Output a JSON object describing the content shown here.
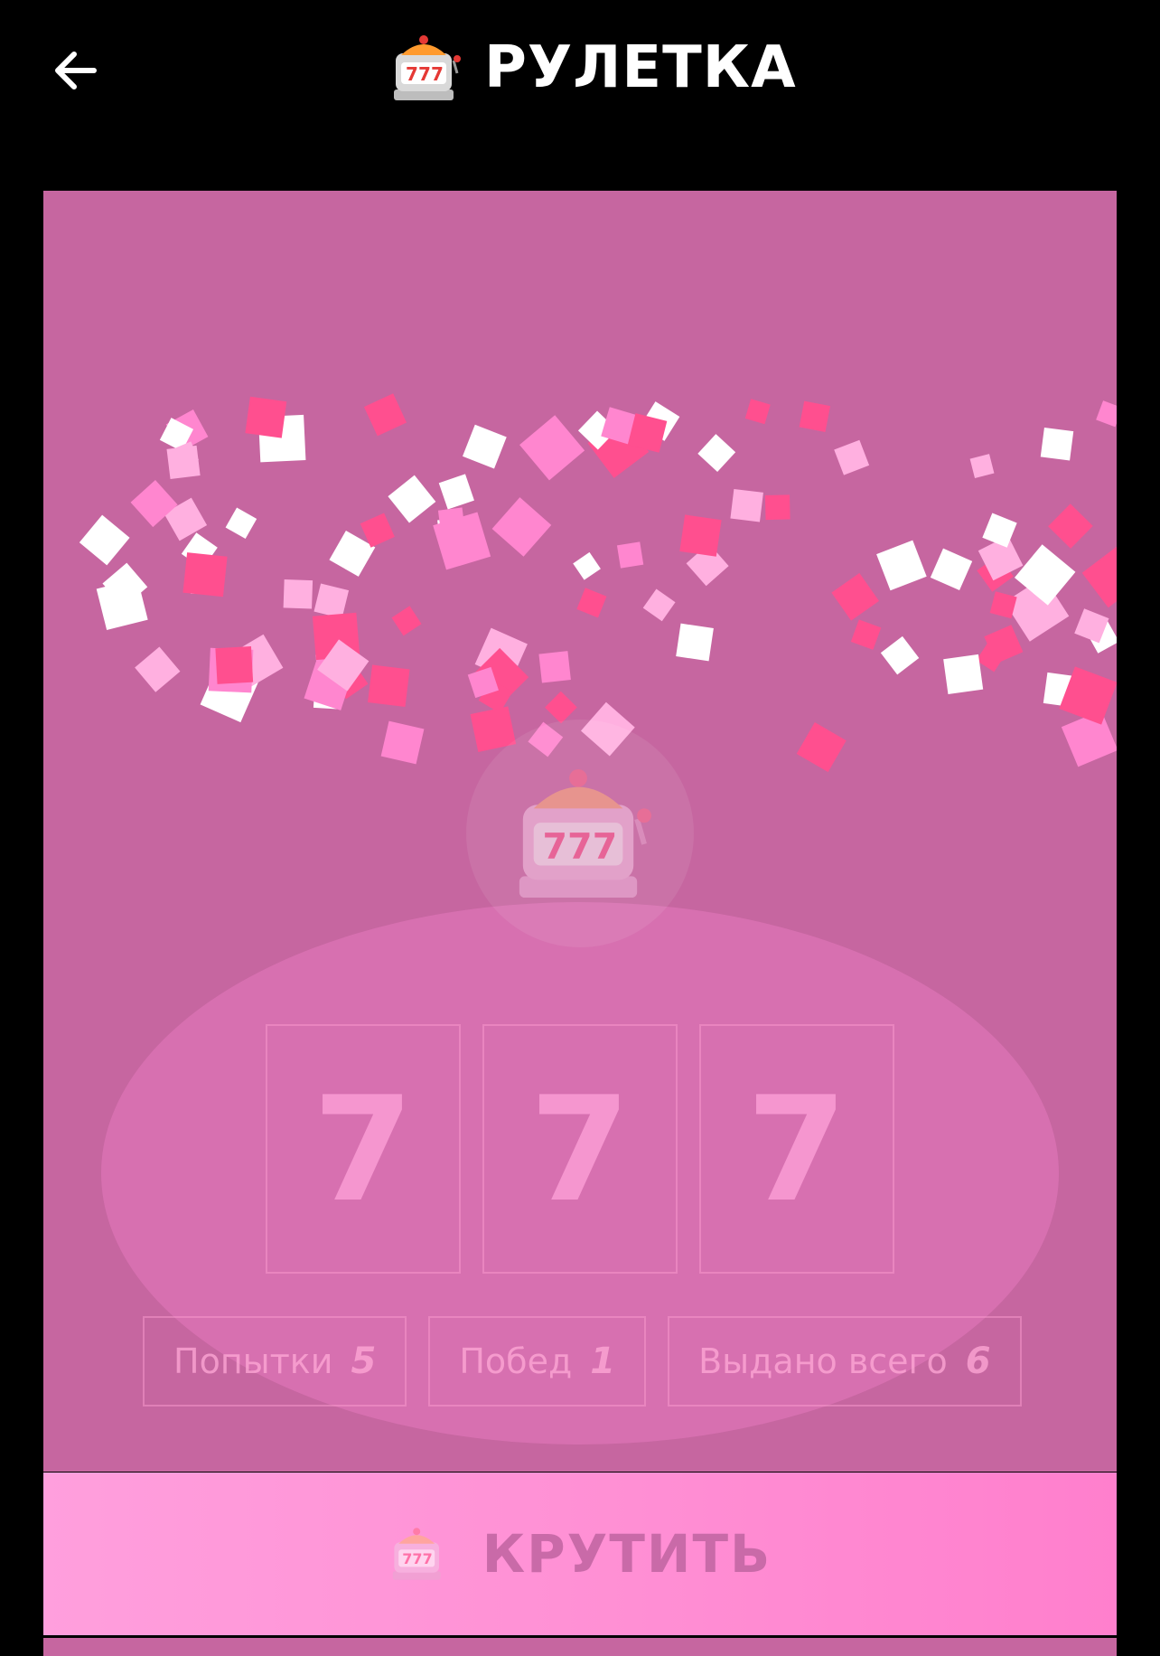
{
  "header": {
    "title": "РУЛЕТКА",
    "back_icon": "arrow-left-icon",
    "logo_icon": "slot-machine-icon"
  },
  "machine": {
    "icon": "slot-machine-icon"
  },
  "reels": [
    "7",
    "7",
    "7"
  ],
  "stats": [
    {
      "label": "Попытки",
      "value": "5"
    },
    {
      "label": "Побед",
      "value": "1"
    },
    {
      "label": "Выдано всего",
      "value": "6"
    }
  ],
  "spin_button": {
    "label": "КРУТИТЬ",
    "icon": "slot-machine-icon"
  },
  "colors": {
    "panel": "#c666a0",
    "confetti": [
      "#ffffff",
      "#ff4f8f",
      "#ff86cf",
      "#ffb0e0"
    ]
  }
}
